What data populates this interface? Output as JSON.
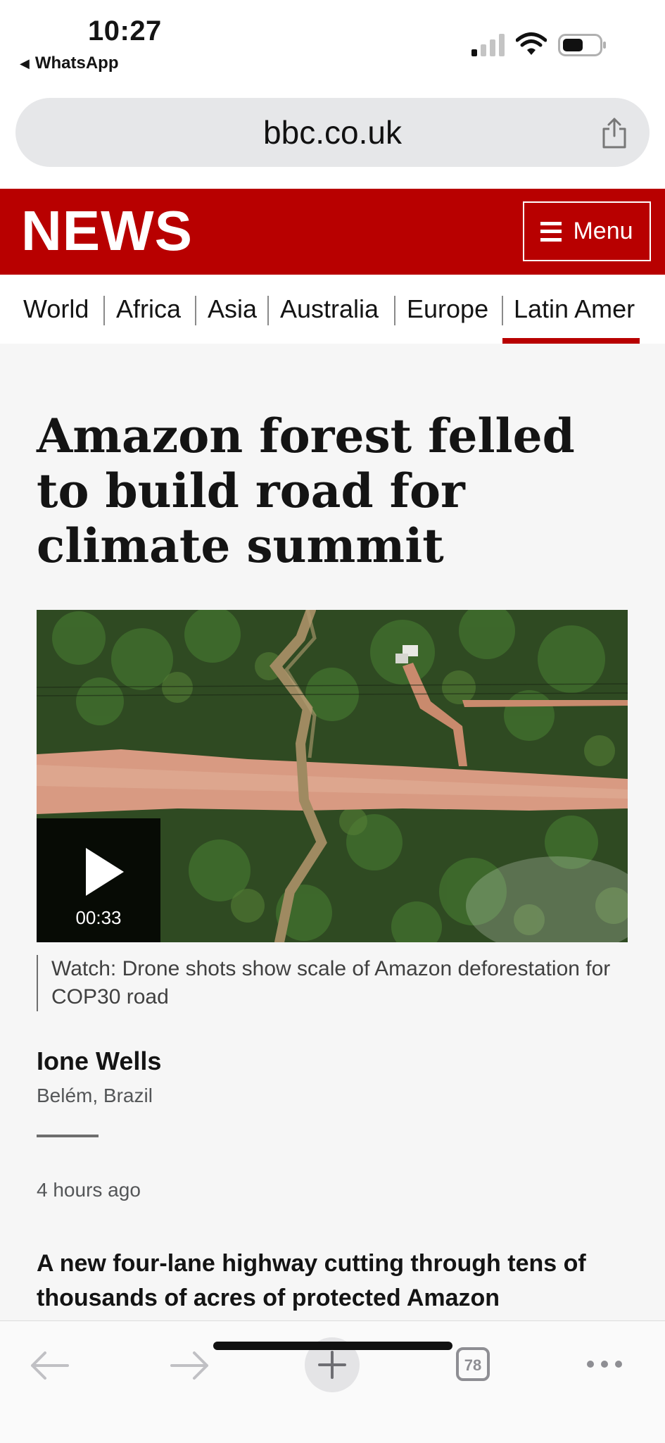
{
  "status_bar": {
    "time": "10:27",
    "back_app": "WhatsApp",
    "icons": [
      "cellular-signal-icon",
      "wifi-icon",
      "battery-icon"
    ]
  },
  "browser": {
    "url": "bbc.co.uk",
    "share_icon": "share-icon"
  },
  "header": {
    "logo": "NEWS",
    "menu_label": "Menu",
    "brand_color": "#b80000"
  },
  "nav": {
    "items": [
      "World",
      "Africa",
      "Asia",
      "Australia",
      "Europe",
      "Latin Amer"
    ],
    "active": "Latin Amer"
  },
  "article": {
    "headline": "Amazon forest felled to build road for climate summit",
    "video": {
      "duration": "00:33",
      "caption": "Watch: Drone shots show scale of Amazon deforestation for COP30 road"
    },
    "author": "Ione Wells",
    "location": "Belém, Brazil",
    "timestamp": "4 hours ago",
    "lead": "A new four-lane highway cutting through tens of thousands of acres of protected Amazon"
  },
  "toolbar": {
    "tab_count": "78",
    "icons": [
      "back-arrow-icon",
      "forward-arrow-icon",
      "new-tab-plus-icon",
      "tabs-icon",
      "more-dots-icon"
    ]
  }
}
